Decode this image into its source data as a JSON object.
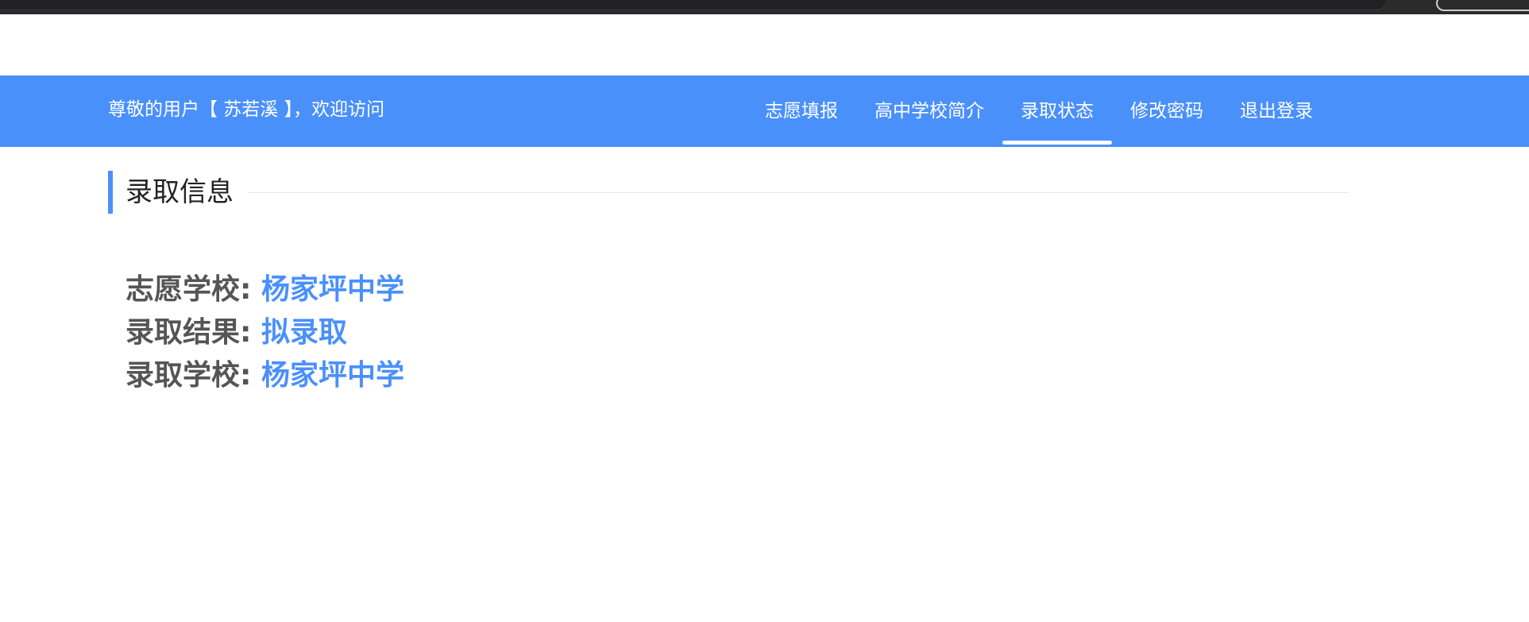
{
  "colors": {
    "accent": "#4a90fb",
    "nav_text": "#ffffff",
    "label_text": "#555555",
    "title_text": "#222222"
  },
  "header": {
    "welcome": "尊敬的用户【 苏若溪 】，欢迎访问",
    "nav": [
      {
        "label": "志愿填报",
        "active": false
      },
      {
        "label": "高中学校简介",
        "active": false
      },
      {
        "label": "录取状态",
        "active": true
      },
      {
        "label": "修改密码",
        "active": false
      },
      {
        "label": "退出登录",
        "active": false
      }
    ]
  },
  "section": {
    "title": "录取信息"
  },
  "admission": {
    "rows": [
      {
        "label": "志愿学校:",
        "value": "杨家坪中学"
      },
      {
        "label": "录取结果:",
        "value": "拟录取"
      },
      {
        "label": "录取学校:",
        "value": "杨家坪中学"
      }
    ]
  }
}
